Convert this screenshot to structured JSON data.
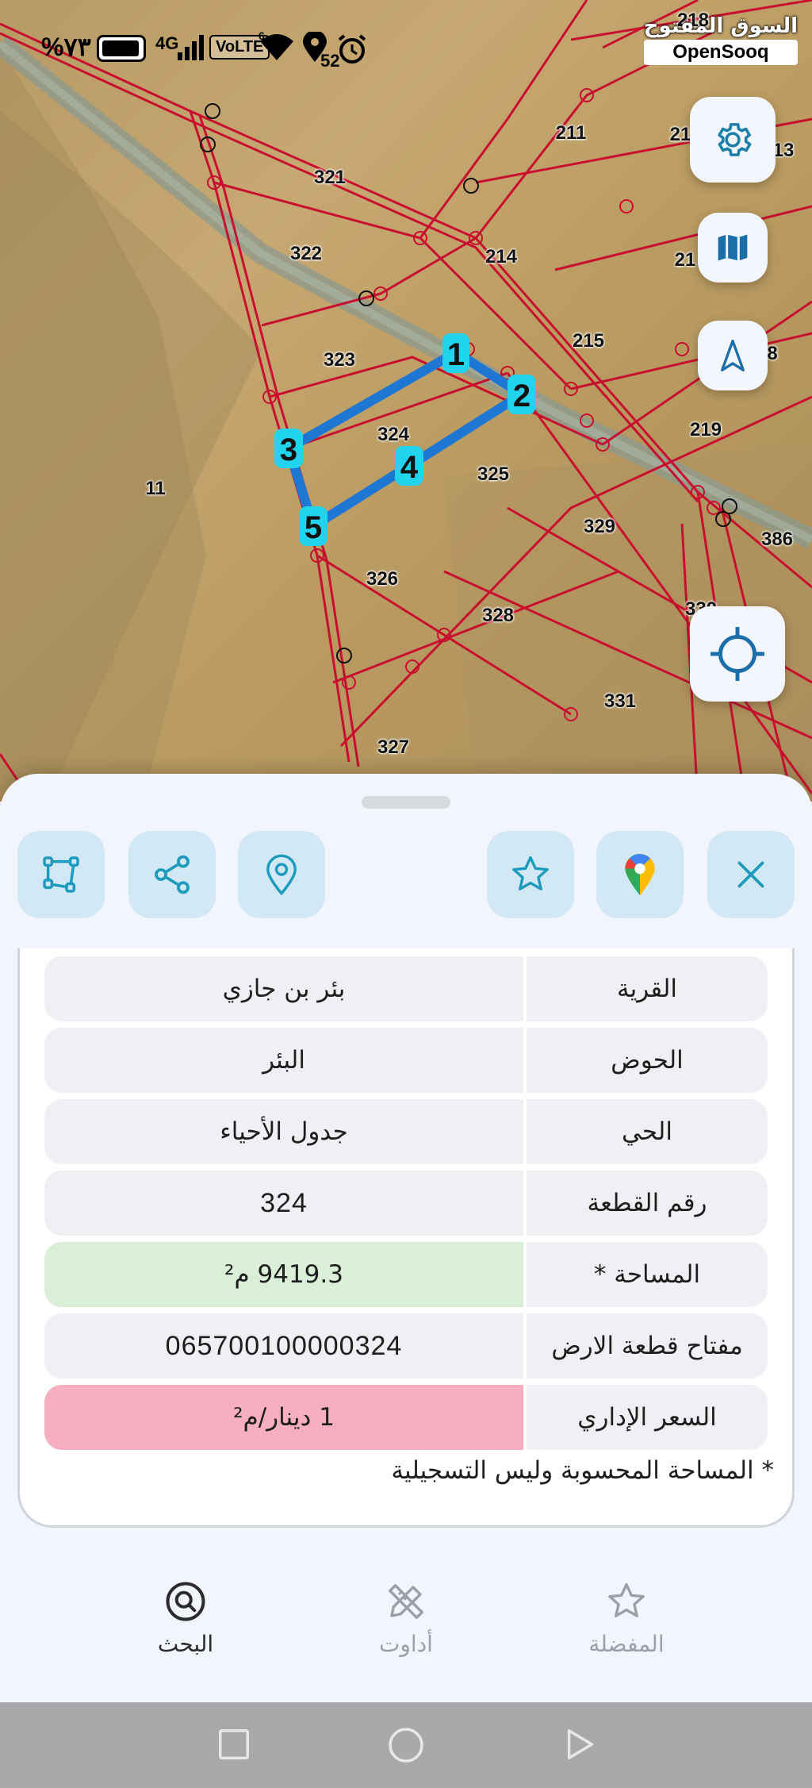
{
  "status_bar": {
    "battery_percent": "%٧٣",
    "network": "4G",
    "volte": "VoLTE",
    "wifi_level": "6",
    "notification_count": "52"
  },
  "watermark": {
    "arabic": "السوق المفتوح",
    "english": "OpenSooq"
  },
  "map": {
    "parcels": [
      {
        "id": "p218",
        "label": "218"
      },
      {
        "id": "p211",
        "label": "211"
      },
      {
        "id": "p21a",
        "label": "21"
      },
      {
        "id": "p13",
        "label": "13"
      },
      {
        "id": "p321",
        "label": "321"
      },
      {
        "id": "p322",
        "label": "322"
      },
      {
        "id": "p214",
        "label": "214"
      },
      {
        "id": "p21b",
        "label": "21"
      },
      {
        "id": "p323",
        "label": "323"
      },
      {
        "id": "p215",
        "label": "215"
      },
      {
        "id": "p8",
        "label": "8"
      },
      {
        "id": "p324",
        "label": "324"
      },
      {
        "id": "p219",
        "label": "219"
      },
      {
        "id": "p325",
        "label": "325"
      },
      {
        "id": "p11",
        "label": "11"
      },
      {
        "id": "p329",
        "label": "329"
      },
      {
        "id": "p386",
        "label": "386"
      },
      {
        "id": "p326",
        "label": "326"
      },
      {
        "id": "p328",
        "label": "328"
      },
      {
        "id": "p33x",
        "label": "330"
      },
      {
        "id": "p331",
        "label": "331"
      },
      {
        "id": "p327",
        "label": "327"
      }
    ],
    "vertices": [
      "1",
      "2",
      "3",
      "4",
      "5"
    ]
  },
  "actions": {
    "draw_polygon": "draw-polygon",
    "share": "share",
    "location_pin": "location-pin",
    "favorite": "star",
    "google_maps": "google-maps",
    "close": "close"
  },
  "details": [
    {
      "label": "القرية",
      "value": "بئر بن جازي"
    },
    {
      "label": "الحوض",
      "value": "البئر"
    },
    {
      "label": "الحي",
      "value": "جدول الأحياء"
    },
    {
      "label": "رقم القطعة",
      "value": "324"
    },
    {
      "label": "المساحة *",
      "value": "9419.3 م²"
    },
    {
      "label": "مفتاح قطعة الارض",
      "value": "065700100000324"
    },
    {
      "label": "السعر الإداري",
      "value": "1 دينار/م²"
    }
  ],
  "footnote": "* المساحة المحسوبة وليس التسجيلية",
  "bottom_nav": {
    "search": "البحث",
    "tools": "أداوت",
    "favorites": "المفضلة"
  },
  "colors": {
    "parcel_line": "#c8102e",
    "selected_outline": "#1f77d4",
    "vertex_marker": "#22d3ee",
    "area_bg": "#d9efd7",
    "price_bg": "#f6aec0",
    "action_bg": "#d2e8f5",
    "icon_accent": "#1c9bbd"
  }
}
